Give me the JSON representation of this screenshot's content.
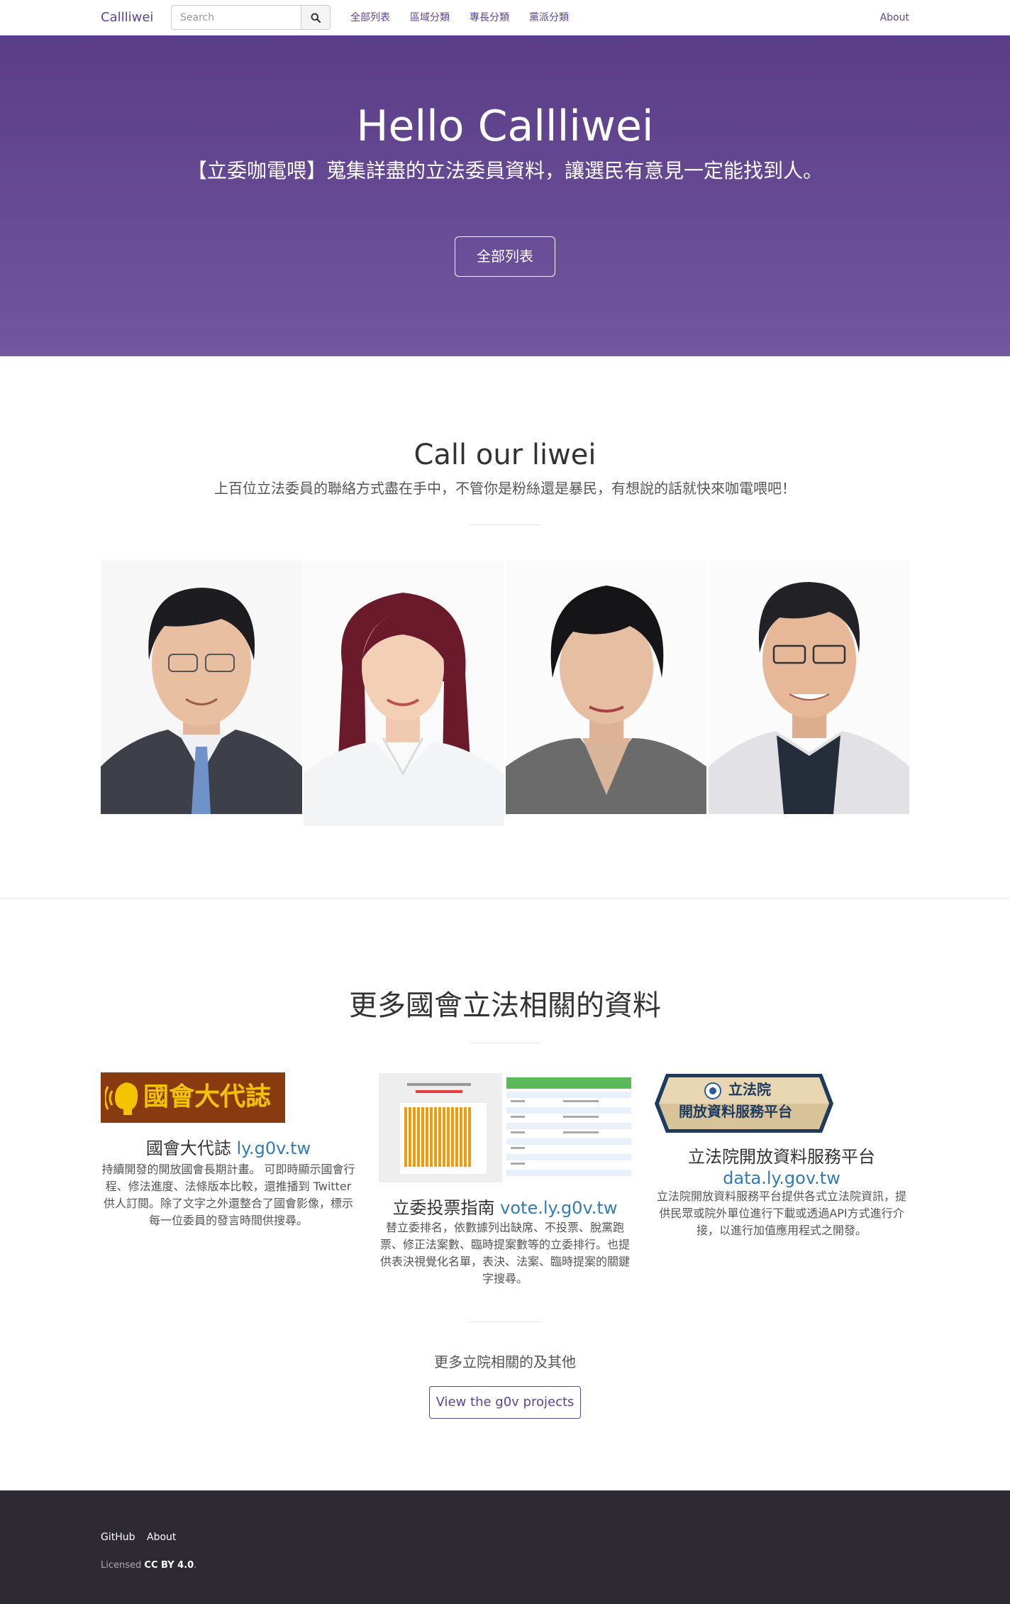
{
  "nav": {
    "brand": "Callliwei",
    "search_placeholder": "Search",
    "links": [
      "全部列表",
      "區域分類",
      "專長分類",
      "黨派分類"
    ],
    "about": "About"
  },
  "hero": {
    "title": "Hello Callliwei",
    "subtitle": "【立委咖電喂】蒐集詳盡的立法委員資料，讓選民有意見一定能找到人。",
    "button": "全部列表"
  },
  "liwei_section": {
    "title": "Call our liwei",
    "subtitle": "上百位立法委員的聯絡方式盡在手中，不管你是粉絲還是暴民，有想說的話就快來咖電喂吧！"
  },
  "resources": {
    "title": "更多國會立法相關的資料",
    "items": [
      {
        "logo_text": "國會大代誌",
        "title": "國會大代誌 ",
        "link": "ly.g0v.tw",
        "desc": "持續開發的開放國會長期計畫。 可即時顯示國會行程、修法進度、法條版本比較，還推播到 Twitter 供人訂閱。除了文字之外還整合了國會影像，標示每一位委員的發言時間供搜尋。"
      },
      {
        "title": "立委投票指南 ",
        "link": "vote.ly.g0v.tw",
        "desc": "替立委排名，依數據列出缺席、不投票、脫黨跑票、修正法案數、臨時提案數等的立委排行。也提供表決視覺化名單，表決、法案、臨時提案的關鍵字搜尋。"
      },
      {
        "logo_line1": "立法院",
        "logo_line2": "開放資料服務平台",
        "title": "立法院開放資料服務平台",
        "link": "data.ly.gov.tw",
        "desc": "立法院開放資料服務平台提供各式立法院資訊，提供民眾或院外單位進行下載或透過API方式進行介接，以進行加值應用程式之開發。"
      }
    ],
    "more_label": "更多立院相關的及其他",
    "more_button": "View the g0v projects"
  },
  "footer": {
    "links": [
      "GitHub",
      "About"
    ],
    "license_prefix": "Licensed ",
    "license": "CC BY 4.0",
    "license_suffix": "."
  },
  "colors": {
    "brand": "#5e4591",
    "hero_top": "#5a3d86",
    "hero_bottom": "#7256a0",
    "link": "#337ab7",
    "footer_bg": "#2e2a33"
  }
}
